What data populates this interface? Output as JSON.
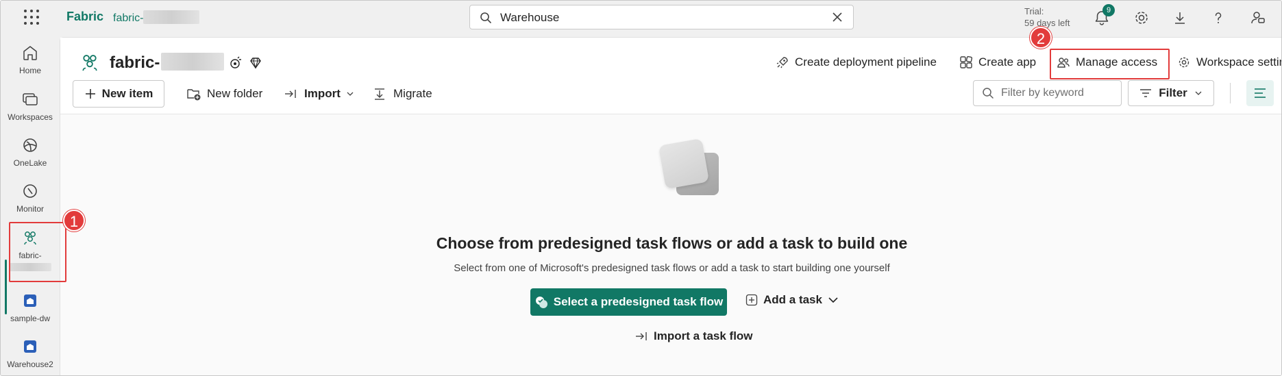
{
  "topbar": {
    "app_name": "Fabric",
    "workspace_prefix": "fabric-",
    "search": {
      "value": "Warehouse",
      "placeholder": "Search"
    },
    "trial_label": "Trial:",
    "trial_days": "59 days left",
    "notification_count": "9",
    "icons": [
      "waffle-icon",
      "bell-icon",
      "gear-icon",
      "download-icon",
      "help-icon",
      "people-feedback-icon"
    ]
  },
  "rail": {
    "items": [
      {
        "label": "Home",
        "icon": "home-icon"
      },
      {
        "label": "Workspaces",
        "icon": "workspaces-icon"
      },
      {
        "label": "OneLake",
        "icon": "onelake-icon"
      },
      {
        "label": "Monitor",
        "icon": "monitor-icon"
      },
      {
        "label": "fabric-",
        "icon": "workspace-group-icon"
      },
      {
        "label": "sample-dw",
        "icon": "warehouse-icon"
      },
      {
        "label": "Warehouse2",
        "icon": "warehouse-icon"
      }
    ]
  },
  "workspace": {
    "title": "fabric-",
    "actions": {
      "deployment": "Create deployment pipeline",
      "create_app": "Create app",
      "manage_access": "Manage access",
      "settings": "Workspace settin"
    },
    "commands": {
      "new_item": "New item",
      "new_folder": "New folder",
      "import": "Import",
      "migrate": "Migrate"
    },
    "filter": {
      "placeholder": "Filter by keyword",
      "button": "Filter"
    }
  },
  "empty_state": {
    "headline": "Choose from predesigned task flows or add a task to build one",
    "subtitle": "Select from one of Microsoft's predesigned task flows or add a task to start building one yourself",
    "primary_button": "Select a predesigned task flow",
    "add_task": "Add a task",
    "import_flow": "Import a task flow"
  },
  "annotations": {
    "step1": "1",
    "step2": "2"
  },
  "colors": {
    "accent": "#117865",
    "highlight": "#e23b3b"
  }
}
